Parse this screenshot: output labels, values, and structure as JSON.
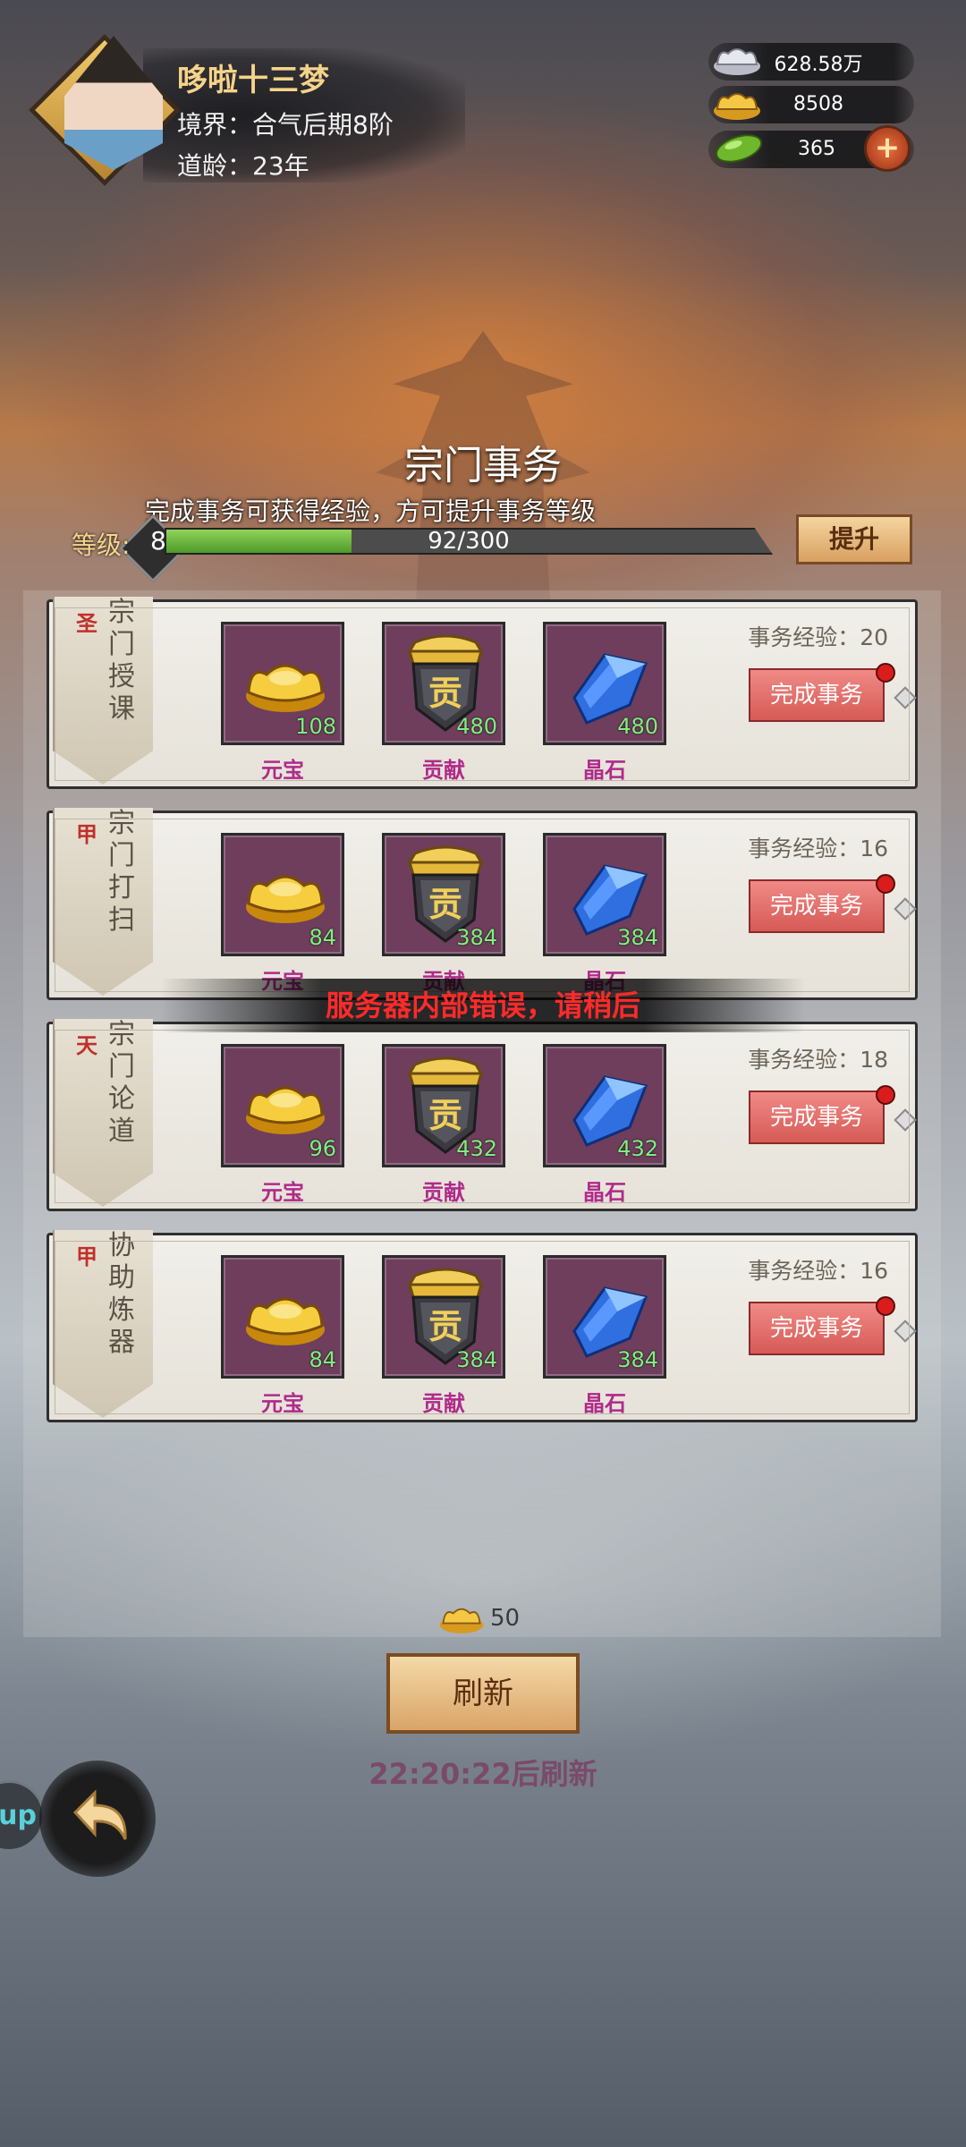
{
  "player": {
    "name": "哆啦十三梦",
    "realm": "境界：合气后期8阶",
    "age": "道龄：23年"
  },
  "currencies": [
    {
      "icon": "silver-ingot-icon",
      "value": "628.58万"
    },
    {
      "icon": "gold-ingot-icon",
      "value": "8508"
    },
    {
      "icon": "jade-icon",
      "value": "365"
    }
  ],
  "plus_label": "+",
  "title": "宗门事务",
  "subtitle": "完成事务可获得经验，方可提升事务等级",
  "level": {
    "label": "等级:",
    "value": "8",
    "progress_text": "92/300",
    "current": 92,
    "max": 300
  },
  "upgrade_label": "提升",
  "tasks": [
    {
      "grade": "圣",
      "name": "宗门授课",
      "exp": "事务经验：20",
      "button": "完成事务",
      "rewards": [
        {
          "name": "元宝",
          "amount": "108",
          "icon": "gold-ingot-icon"
        },
        {
          "name": "贡献",
          "amount": "480",
          "icon": "contribution-badge-icon"
        },
        {
          "name": "晶石",
          "amount": "480",
          "icon": "crystal-icon"
        }
      ]
    },
    {
      "grade": "甲",
      "name": "宗门打扫",
      "exp": "事务经验：16",
      "button": "完成事务",
      "rewards": [
        {
          "name": "元宝",
          "amount": "84",
          "icon": "gold-ingot-icon"
        },
        {
          "name": "贡献",
          "amount": "384",
          "icon": "contribution-badge-icon"
        },
        {
          "name": "晶石",
          "amount": "384",
          "icon": "crystal-icon"
        }
      ]
    },
    {
      "grade": "天",
      "name": "宗门论道",
      "exp": "事务经验：18",
      "button": "完成事务",
      "rewards": [
        {
          "name": "元宝",
          "amount": "96",
          "icon": "gold-ingot-icon"
        },
        {
          "name": "贡献",
          "amount": "432",
          "icon": "contribution-badge-icon"
        },
        {
          "name": "晶石",
          "amount": "432",
          "icon": "crystal-icon"
        }
      ]
    },
    {
      "grade": "甲",
      "name": "协助炼器",
      "exp": "事务经验：16",
      "button": "完成事务",
      "rewards": [
        {
          "name": "元宝",
          "amount": "84",
          "icon": "gold-ingot-icon"
        },
        {
          "name": "贡献",
          "amount": "384",
          "icon": "contribution-badge-icon"
        },
        {
          "name": "晶石",
          "amount": "384",
          "icon": "crystal-icon"
        }
      ]
    }
  ],
  "badge_char": "贡",
  "error_toast": "服务器内部错误，请稍后",
  "refresh": {
    "cost": "50",
    "label": "刷新",
    "timer": "22:20:22后刷新"
  },
  "left_peek_text": "up"
}
